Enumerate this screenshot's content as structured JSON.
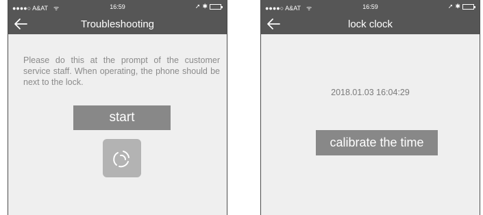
{
  "screens": [
    {
      "status_bar": {
        "carrier": "●●●●○ A&AT",
        "time": "16:59"
      },
      "nav": {
        "title": "Troubleshooting",
        "back_icon": "back-arrow-icon"
      },
      "instructions": "Please do this at the prompt of the customer service staff. When operating, the phone should be next to the lock.",
      "start_label": "start",
      "loader_icon": "loading-spinner-icon"
    },
    {
      "status_bar": {
        "carrier": "●●●●○ A&AT",
        "time": "16:59"
      },
      "nav": {
        "title": "lock clock",
        "back_icon": "back-arrow-icon"
      },
      "datetime": "2018.01.03 16:04:29",
      "calibrate_label": "calibrate the time"
    }
  ],
  "colors": {
    "bar": "#565656",
    "background": "#efefef",
    "button": "#888888",
    "hint_text": "#8a8a8a"
  }
}
